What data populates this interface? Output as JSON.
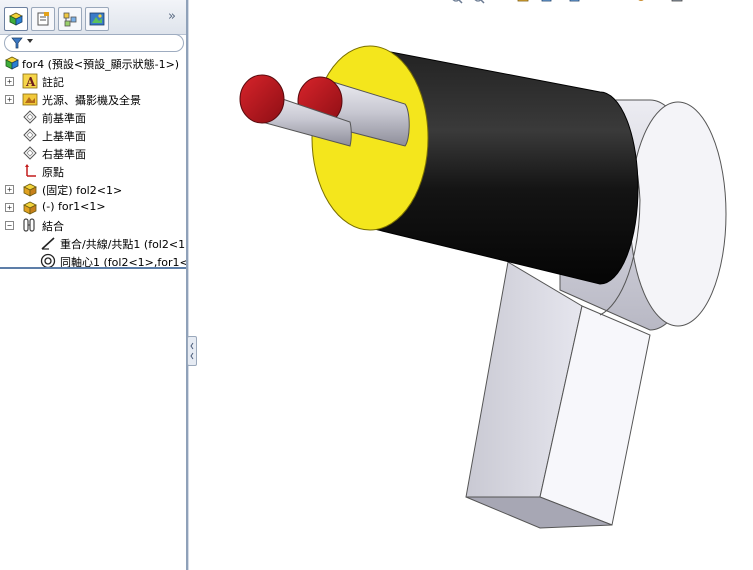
{
  "feature_tree": {
    "tabs": [
      "feature-manager-tab",
      "property-manager-tab",
      "configuration-manager-tab",
      "display-manager-tab"
    ],
    "expand_glyph": "»",
    "root_label": "for4  (預設<預設_顯示狀態-1>)",
    "items": [
      {
        "label": "註記",
        "icon": "annotations-icon",
        "expand": "+"
      },
      {
        "label": "光源、攝影機及全景",
        "icon": "lights-cameras-icon",
        "expand": "+"
      },
      {
        "label": "前基準面",
        "icon": "plane-icon",
        "expand": ""
      },
      {
        "label": "上基準面",
        "icon": "plane-icon",
        "expand": ""
      },
      {
        "label": "右基準面",
        "icon": "plane-icon",
        "expand": ""
      },
      {
        "label": "原點",
        "icon": "origin-icon",
        "expand": ""
      },
      {
        "label": "(固定) fol2<1>",
        "icon": "part-icon",
        "expand": "+"
      },
      {
        "label": "(-) for1<1>",
        "icon": "part-icon",
        "expand": "+"
      },
      {
        "label": "結合",
        "icon": "mates-icon",
        "expand": "−"
      },
      {
        "label": "重合/共線/共點1 (fol2<1",
        "icon": "coincident-mate-icon",
        "expand": ""
      },
      {
        "label": "同軸心1 (fol2<1>,for1<:",
        "icon": "concentric-mate-icon",
        "expand": ""
      }
    ]
  },
  "viewport": {
    "colors": {
      "black_cylinder": "#121212",
      "yellow_face": "#f4e61c",
      "red_caps": "#b7151d",
      "grey_body": "#d4d4dc",
      "background": "#ffffff"
    }
  }
}
